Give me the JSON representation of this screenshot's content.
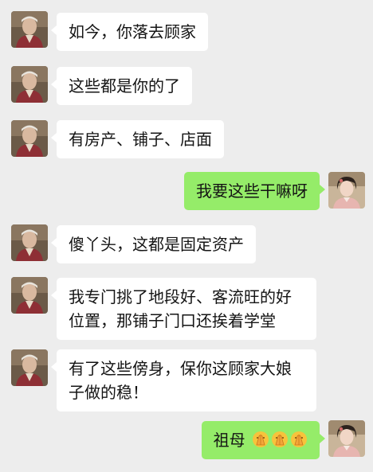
{
  "chat": {
    "messages": [
      {
        "sender": "grandmother",
        "side": "left",
        "text": "如今，你落去顾家"
      },
      {
        "sender": "grandmother",
        "side": "left",
        "text": "这些都是你的了"
      },
      {
        "sender": "grandmother",
        "side": "left",
        "text": "有房产、铺子、店面"
      },
      {
        "sender": "girl",
        "side": "right",
        "text": "我要这些干嘛呀"
      },
      {
        "sender": "grandmother",
        "side": "left",
        "text": "傻丫头，这都是固定资产"
      },
      {
        "sender": "grandmother",
        "side": "left",
        "text": "我专门挑了地段好、客流旺的好位置，那铺子门口还挨着学堂"
      },
      {
        "sender": "grandmother",
        "side": "left",
        "text": "有了这些傍身，保你这顾家大娘子做的稳！"
      },
      {
        "sender": "girl",
        "side": "right",
        "text": "祖母",
        "emoji": [
          "pray-icon",
          "pray-icon",
          "pray-icon"
        ]
      }
    ]
  },
  "colors": {
    "background": "#ededed",
    "incoming_bubble": "#ffffff",
    "outgoing_bubble": "#95ec69",
    "text": "#141414"
  }
}
